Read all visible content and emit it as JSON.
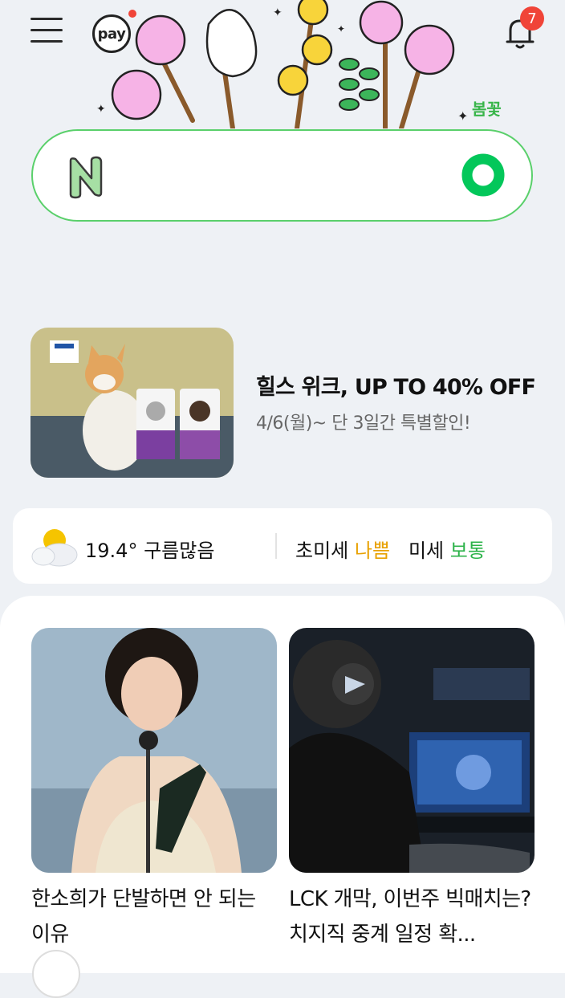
{
  "header": {
    "pay_label": "pay",
    "notification_count": "7",
    "doodle_tag": "봄꽃"
  },
  "search": {
    "placeholder": "",
    "value": ""
  },
  "ad": {
    "title": "힐스 위크, UP TO 40% OFF",
    "subtitle": "4/6(월)~ 단 3일간 특별할인!"
  },
  "weather": {
    "temp": "19.4°",
    "condition": "구름많음",
    "fine_dust_label": "초미세",
    "fine_dust_value": "나쁨",
    "dust_label": "미세",
    "dust_value": "보통"
  },
  "news": [
    {
      "title": "한소희가 단발하면 안 되는 이유"
    },
    {
      "title": "LCK 개막, 이번주 빅매치는? 치지직 중계 일정 확..."
    }
  ],
  "colors": {
    "accent_green": "#03c75a",
    "badge_red": "#f04438",
    "bad": "#e8a100",
    "ok": "#2db34a"
  }
}
